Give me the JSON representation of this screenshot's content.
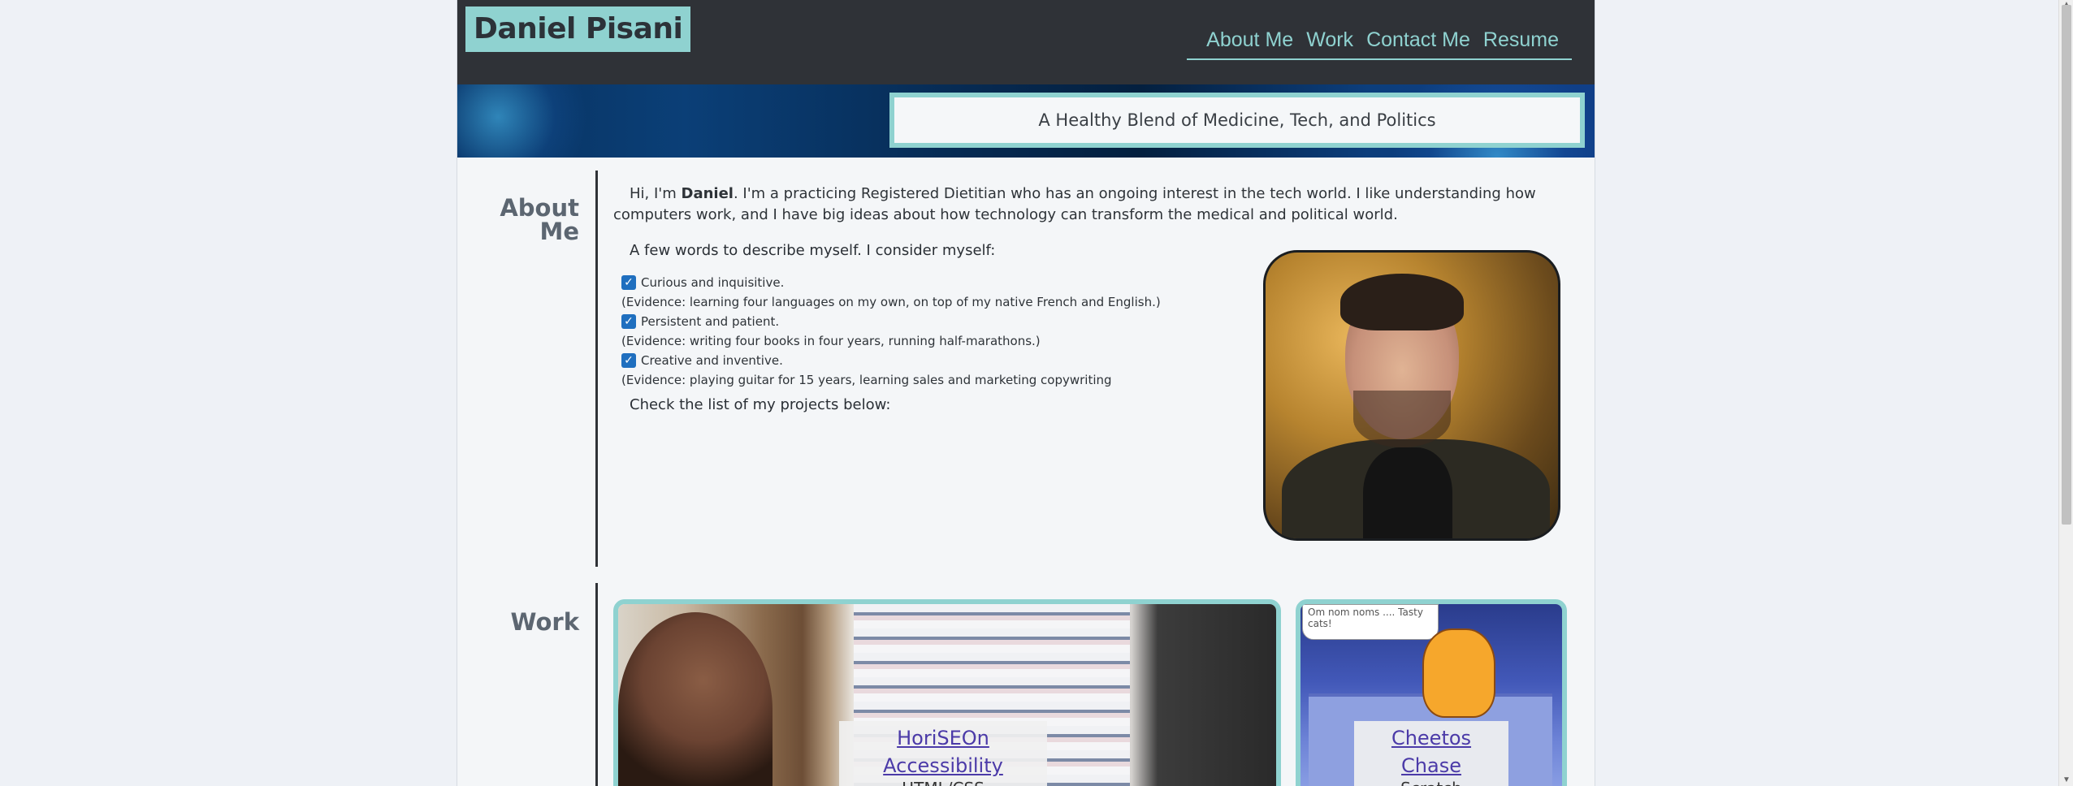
{
  "header": {
    "brand": "Daniel Pisani",
    "nav": [
      "About Me",
      "Work",
      "Contact Me",
      "Resume"
    ]
  },
  "hero": {
    "tagline": "A Healthy Blend of Medicine, Tech, and Politics"
  },
  "about": {
    "title_line1": "About",
    "title_line2": "Me",
    "intro_pre": "Hi, I'm ",
    "intro_name": "Daniel",
    "intro_post": ". I'm a practicing Registered Dietitian who has an ongoing interest in the tech world. I like understanding how computers work, and I have big ideas about how technology can transform the medical and political world.",
    "intro2": "A few words to describe myself. I consider myself:",
    "traits": [
      {
        "label": "Curious and inquisitive.",
        "evidence": "(Evidence: learning four languages on my own, on top of my native French and English.)"
      },
      {
        "label": "Persistent and patient.",
        "evidence": "(Evidence: writing four books in four years, running half-marathons.)"
      },
      {
        "label": "Creative and inventive.",
        "evidence": "(Evidence: playing guitar for 15 years, learning sales and marketing copywriting"
      }
    ],
    "outro": "Check the list of my projects below:"
  },
  "work": {
    "title": "Work",
    "projects": [
      {
        "name": "HoriSEOn Accessibility",
        "tech": "HTML/CSS"
      },
      {
        "name": "Cheetos Chase",
        "tech": "Scratch",
        "speech": "Om nom noms .... Tasty cats!"
      }
    ]
  },
  "colors": {
    "accent": "#8fd2d0",
    "header_bg": "#2f3237",
    "link": "#4b3aa8"
  }
}
